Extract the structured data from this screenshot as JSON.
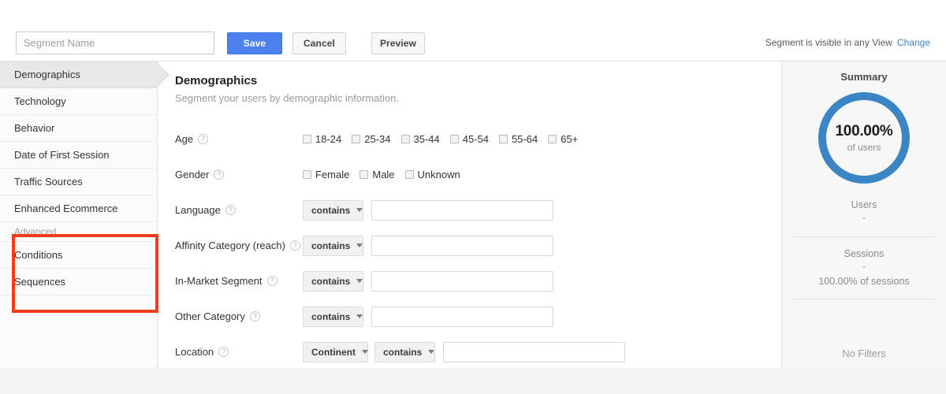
{
  "topbar": {
    "segment_name_placeholder": "Segment Name",
    "segment_name_value": "",
    "save_label": "Save",
    "cancel_label": "Cancel",
    "preview_label": "Preview",
    "visibility_text": "Segment is visible in any View",
    "change_link": "Change"
  },
  "sidebar": {
    "items": [
      {
        "label": "Demographics",
        "active": true
      },
      {
        "label": "Technology",
        "active": false
      },
      {
        "label": "Behavior",
        "active": false
      },
      {
        "label": "Date of First Session",
        "active": false
      },
      {
        "label": "Traffic Sources",
        "active": false
      },
      {
        "label": "Enhanced Ecommerce",
        "active": false
      }
    ],
    "advanced_group_label": "Advanced",
    "advanced_items": [
      {
        "label": "Conditions"
      },
      {
        "label": "Sequences"
      }
    ],
    "annotation_color": "#f03c18"
  },
  "content": {
    "title": "Demographics",
    "subtitle": "Segment your users by demographic information.",
    "help_glyph": "?",
    "age": {
      "label": "Age",
      "options": [
        {
          "label": "18-24",
          "checked": false
        },
        {
          "label": "25-34",
          "checked": false
        },
        {
          "label": "35-44",
          "checked": false
        },
        {
          "label": "45-54",
          "checked": false
        },
        {
          "label": "55-64",
          "checked": false
        },
        {
          "label": "65+",
          "checked": false
        }
      ]
    },
    "gender": {
      "label": "Gender",
      "options": [
        {
          "label": "Female",
          "checked": false
        },
        {
          "label": "Male",
          "checked": false
        },
        {
          "label": "Unknown",
          "checked": false
        }
      ]
    },
    "filter_rows": [
      {
        "label": "Language",
        "operator": "contains",
        "value": ""
      },
      {
        "label": "Affinity Category (reach)",
        "operator": "contains",
        "value": ""
      },
      {
        "label": "In-Market Segment",
        "operator": "contains",
        "value": ""
      },
      {
        "label": "Other Category",
        "operator": "contains",
        "value": ""
      }
    ],
    "location": {
      "label": "Location",
      "scope": "Continent",
      "operator": "contains",
      "value": ""
    }
  },
  "summary": {
    "title": "Summary",
    "donut_percent": "100.00%",
    "donut_caption": "of users",
    "donut_color": "#3b85c4",
    "users_label": "Users",
    "users_value": "-",
    "sessions_label": "Sessions",
    "sessions_value": "-",
    "sessions_pct": "100.00% of sessions",
    "no_filters": "No Filters"
  }
}
